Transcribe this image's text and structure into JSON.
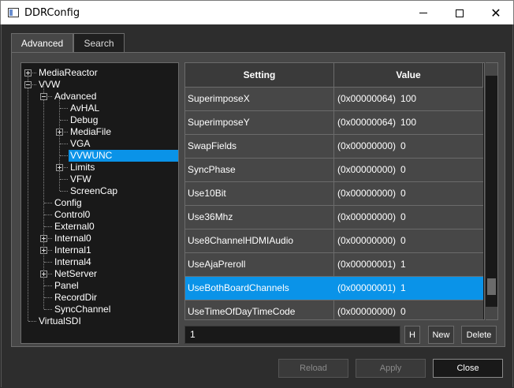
{
  "window": {
    "title": "DDRConfig",
    "minimize_label": "",
    "maximize_label": "",
    "close_glyph": "✕"
  },
  "tabs": [
    {
      "label": "Advanced",
      "active": true
    },
    {
      "label": "Search",
      "active": false
    }
  ],
  "tree": {
    "items": [
      {
        "label": "MediaReactor",
        "expander": "plus"
      },
      {
        "label": "VVW",
        "expander": "minus"
      },
      {
        "label": "Advanced",
        "expander": "minus"
      },
      {
        "label": "AvHAL",
        "expander": ""
      },
      {
        "label": "Debug",
        "expander": ""
      },
      {
        "label": "MediaFile",
        "expander": "plus"
      },
      {
        "label": "VGA",
        "expander": ""
      },
      {
        "label": "VVWUNC",
        "expander": "",
        "selected": true
      },
      {
        "label": "Limits",
        "expander": "plus"
      },
      {
        "label": "VFW",
        "expander": ""
      },
      {
        "label": "ScreenCap",
        "expander": ""
      },
      {
        "label": "Config",
        "expander": ""
      },
      {
        "label": "Control0",
        "expander": ""
      },
      {
        "label": "External0",
        "expander": ""
      },
      {
        "label": "Internal0",
        "expander": "plus"
      },
      {
        "label": "Internal1",
        "expander": "plus"
      },
      {
        "label": "Internal4",
        "expander": ""
      },
      {
        "label": "NetServer",
        "expander": "plus"
      },
      {
        "label": "Panel",
        "expander": ""
      },
      {
        "label": "RecordDir",
        "expander": ""
      },
      {
        "label": "SyncChannel",
        "expander": ""
      },
      {
        "label": "VirtualSDI",
        "expander": ""
      }
    ]
  },
  "grid": {
    "headers": {
      "setting": "Setting",
      "value": "Value"
    },
    "rows": [
      {
        "setting": "SuperimposeX",
        "hex": "(0x00000064)",
        "value": "100"
      },
      {
        "setting": "SuperimposeY",
        "hex": "(0x00000064)",
        "value": "100"
      },
      {
        "setting": "SwapFields",
        "hex": "(0x00000000)",
        "value": "0"
      },
      {
        "setting": "SyncPhase",
        "hex": "(0x00000000)",
        "value": "0"
      },
      {
        "setting": "Use10Bit",
        "hex": "(0x00000000)",
        "value": "0"
      },
      {
        "setting": "Use36Mhz",
        "hex": "(0x00000000)",
        "value": "0"
      },
      {
        "setting": "Use8ChannelHDMIAudio",
        "hex": "(0x00000000)",
        "value": "0"
      },
      {
        "setting": "UseAjaPreroll",
        "hex": "(0x00000001)",
        "value": "1"
      },
      {
        "setting": "UseBothBoardChannels",
        "hex": "(0x00000001)",
        "value": "1",
        "selected": true
      },
      {
        "setting": "UseTimeOfDayTimeCode",
        "hex": "(0x00000000)",
        "value": "0"
      }
    ]
  },
  "editor": {
    "value": "1",
    "h_label": "H",
    "new_label": "New",
    "delete_label": "Delete"
  },
  "dialog": {
    "reload_label": "Reload",
    "apply_label": "Apply",
    "close_label": "Close"
  },
  "colors": {
    "selection": "#0a93e8",
    "background": "#2d2d2d",
    "panel": "#474747",
    "field": "#191919"
  }
}
